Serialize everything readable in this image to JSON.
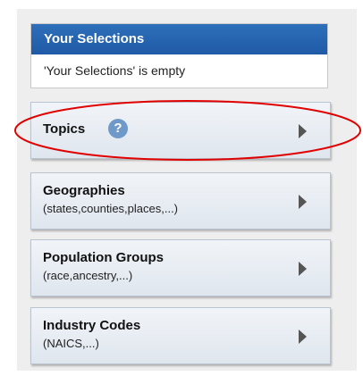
{
  "selections": {
    "title": "Your Selections",
    "status": "'Your Selections' is empty"
  },
  "nav": {
    "topics": {
      "title": "Topics",
      "help_glyph": "?"
    },
    "geographies": {
      "title": "Geographies",
      "subtitle": "(states,counties,places,...)"
    },
    "population": {
      "title": "Population Groups",
      "subtitle": "(race,ancestry,...)"
    },
    "industry": {
      "title": "Industry Codes",
      "subtitle": "(NAICS,...)"
    }
  },
  "icons": {
    "arrow": "triangle-right",
    "help": "question-circle"
  },
  "colors": {
    "header_bg": "#1f5aa6",
    "highlight_ellipse": "#e00000",
    "help_icon": "#6f99c8"
  }
}
